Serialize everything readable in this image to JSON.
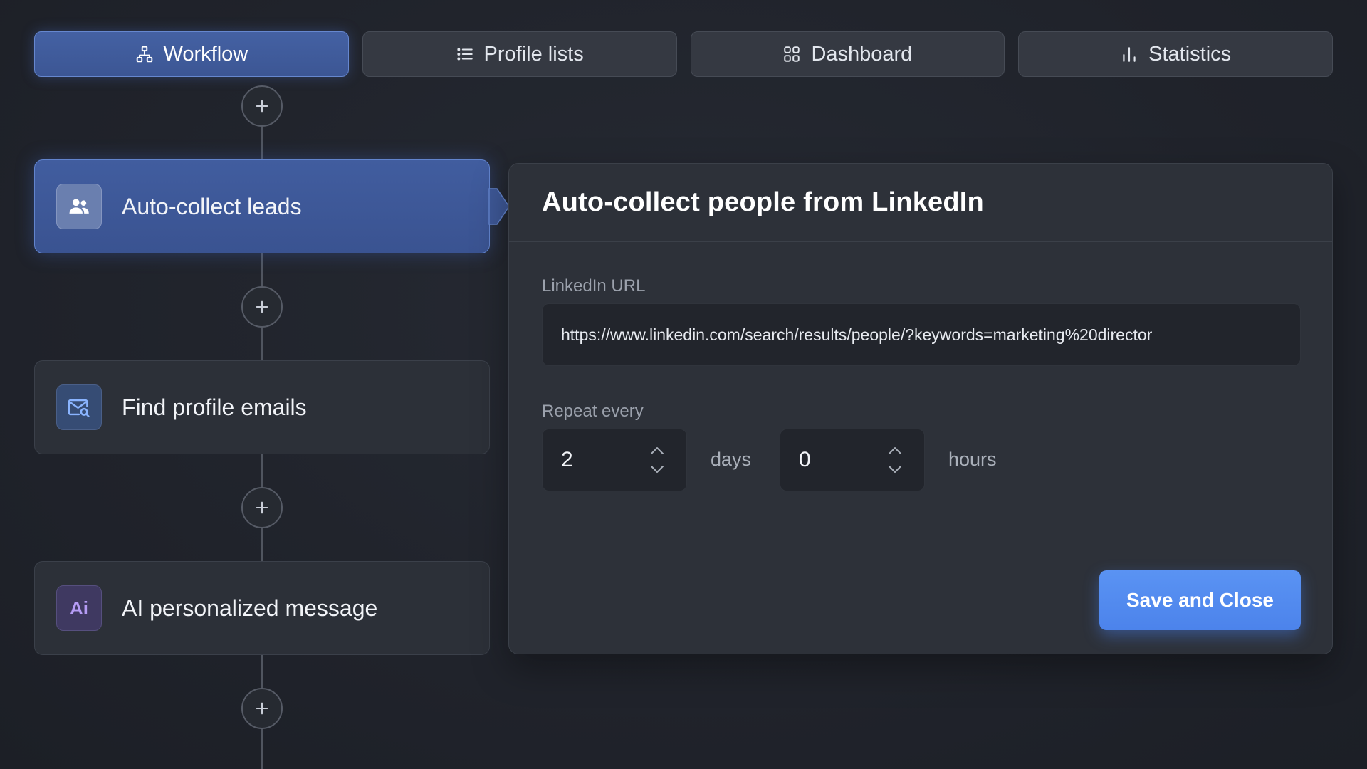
{
  "tabs": [
    {
      "label": "Workflow",
      "icon": "workflow-icon",
      "active": true
    },
    {
      "label": "Profile lists",
      "icon": "list-icon",
      "active": false
    },
    {
      "label": "Dashboard",
      "icon": "grid-icon",
      "active": false
    },
    {
      "label": "Statistics",
      "icon": "bar-chart-icon",
      "active": false
    }
  ],
  "workflow": {
    "steps": [
      {
        "label": "Auto-collect leads",
        "icon": "users-icon",
        "active": true
      },
      {
        "label": "Find profile emails",
        "icon": "mail-search-icon",
        "active": false
      },
      {
        "label": "AI personalized message",
        "icon": "ai-icon",
        "icon_text": "Ai",
        "active": false
      }
    ]
  },
  "panel": {
    "title": "Auto-collect people from LinkedIn",
    "url_label": "LinkedIn URL",
    "url_value": "https://www.linkedin.com/search/results/people/?keywords=marketing%20director",
    "repeat_label": "Repeat every",
    "days_value": "2",
    "days_unit": "days",
    "hours_value": "0",
    "hours_unit": "hours",
    "save_label": "Save and Close"
  },
  "colors": {
    "background": "#21242b",
    "active_blue": "#3f5a9b",
    "primary_button": "#5289ef",
    "ai_accent": "#b59cf5",
    "mail_accent": "#8ab4ff"
  }
}
